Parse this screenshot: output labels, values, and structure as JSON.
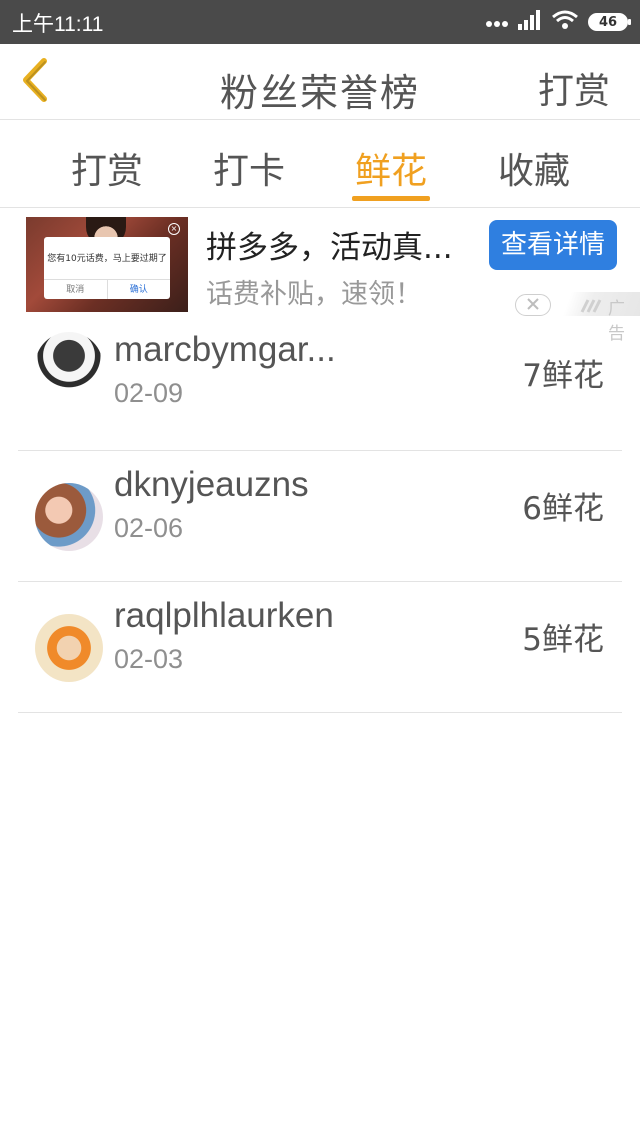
{
  "status_bar": {
    "time": "上午11:11",
    "battery": "46"
  },
  "nav": {
    "title": "粉丝荣誉榜",
    "action": "打赏"
  },
  "tabs": [
    {
      "label": "打赏",
      "active": false
    },
    {
      "label": "打卡",
      "active": false
    },
    {
      "label": "鲜花",
      "active": true
    },
    {
      "label": "收藏",
      "active": false
    }
  ],
  "ad": {
    "title": "拼多多，活动真...",
    "subtitle": "话费补贴，速领！",
    "cta": "查看详情",
    "tag": "广告",
    "thumb_dialog_text": "您有10元话费，马上要过期了",
    "thumb_cancel": "取消",
    "thumb_confirm": "确认"
  },
  "rows": [
    {
      "name": "marcbymgar...",
      "date": "02-09",
      "count": "7鲜花"
    },
    {
      "name": "dknyjeauzns",
      "date": "02-06",
      "count": "6鲜花"
    },
    {
      "name": "raqlplhlaurken",
      "date": "02-03",
      "count": "5鲜花"
    }
  ],
  "colors": {
    "accent": "#f0a020",
    "status_bar": "#4a4a4a",
    "cta": "#2f7fe0"
  },
  "icons": {
    "back": "chevron-left-icon",
    "wifi": "wifi-icon",
    "signal": "signal-icon",
    "battery": "battery-icon",
    "ad_close": "close-icon"
  }
}
